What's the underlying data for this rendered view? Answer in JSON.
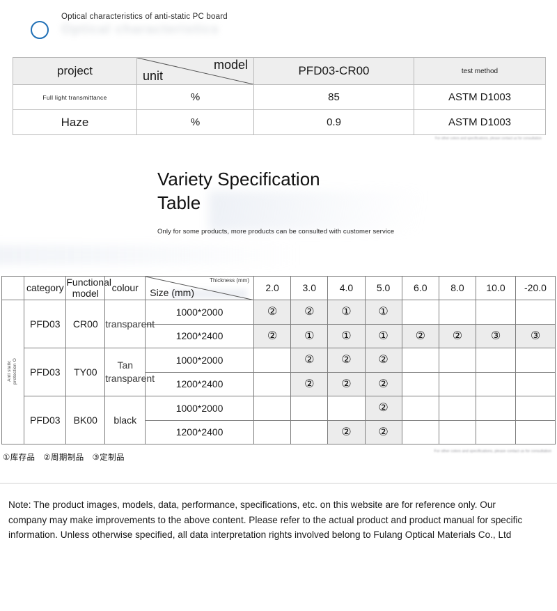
{
  "optical_section": {
    "icon": "ring-icon",
    "title": "Optical characteristics of anti-static PC board",
    "ghost_title": "Optical characteristics",
    "faded_footnote": "For other colors and specifications, please contact us for consultation",
    "table": {
      "headers": {
        "project": "project",
        "unit": "unit",
        "model": "model",
        "model_value": "PFD03-CR00",
        "test_method": "test method"
      },
      "rows": [
        {
          "project": "Full light transmittance",
          "unit": "%",
          "value": "85",
          "test_method": "ASTM D1003"
        },
        {
          "project": "Haze",
          "unit": "%",
          "value": "0.9",
          "test_method": "ASTM D1003"
        }
      ]
    }
  },
  "variety_section": {
    "title_line1": "Variety Specification",
    "title_line2": "Table",
    "subtitle": "Only for some products, more products can be consulted with customer service",
    "table": {
      "row_label_vertical": "Anti static\nprotection O",
      "headers": {
        "category": "category",
        "functional_model": "Functional model",
        "colour": "colour",
        "size": "Size (mm)",
        "thickness": "Thickness (mm)"
      },
      "thickness_columns": [
        "2.0",
        "3.0",
        "4.0",
        "5.0",
        "6.0",
        "8.0",
        "10.0",
        "-20.0"
      ],
      "groups": [
        {
          "category": "PFD03",
          "functional_model": "CR00",
          "colour": "transparent",
          "colour_size": "small",
          "rows": [
            {
              "size": "1000*2000",
              "marks": [
                "②",
                "②",
                "①",
                "①",
                "",
                "",
                "",
                ""
              ],
              "shaded": [
                true,
                true,
                true,
                true,
                false,
                false,
                false,
                false
              ]
            },
            {
              "size": "1200*2400",
              "marks": [
                "②",
                "①",
                "①",
                "①",
                "②",
                "②",
                "③",
                "③"
              ],
              "shaded": [
                true,
                true,
                true,
                true,
                true,
                true,
                true,
                true
              ]
            }
          ]
        },
        {
          "category": "PFD03",
          "functional_model": "TY00",
          "colour": "Tan transparent",
          "colour_size": "small",
          "rows": [
            {
              "size": "1000*2000",
              "marks": [
                "",
                "②",
                "②",
                "②",
                "",
                "",
                "",
                ""
              ],
              "shaded": [
                false,
                true,
                true,
                true,
                false,
                false,
                false,
                false
              ]
            },
            {
              "size": "1200*2400",
              "marks": [
                "",
                "②",
                "②",
                "②",
                "",
                "",
                "",
                ""
              ],
              "shaded": [
                false,
                true,
                true,
                true,
                false,
                false,
                false,
                false
              ]
            }
          ]
        },
        {
          "category": "PFD03",
          "functional_model": "BK00",
          "colour": "black",
          "colour_size": "large",
          "rows": [
            {
              "size": "1000*2000",
              "marks": [
                "",
                "",
                "",
                "②",
                "",
                "",
                "",
                ""
              ],
              "shaded": [
                false,
                false,
                false,
                true,
                false,
                false,
                false,
                false
              ]
            },
            {
              "size": "1200*2400",
              "marks": [
                "",
                "",
                "②",
                "②",
                "",
                "",
                "",
                ""
              ],
              "shaded": [
                false,
                false,
                true,
                true,
                false,
                false,
                false,
                false
              ]
            }
          ]
        }
      ]
    },
    "legend": "①库存品　②周期制品　③定制品",
    "legend_faded": "For other colors and specifications, please contact us for consultation"
  },
  "footer": {
    "note": "Note: The product images, models, data, performance, specifications, etc. on this website are for reference only. Our company may make improvements to the above content. Please refer to the actual product and product manual for specific information. Unless otherwise specified, all data interpretation rights involved belong to Fulang Optical Materials Co., Ltd"
  },
  "colors": {
    "accent": "#1f6fb5",
    "header_bg": "#eeeeee",
    "shade_bg": "#ececec",
    "border": "#7d7d7d"
  }
}
